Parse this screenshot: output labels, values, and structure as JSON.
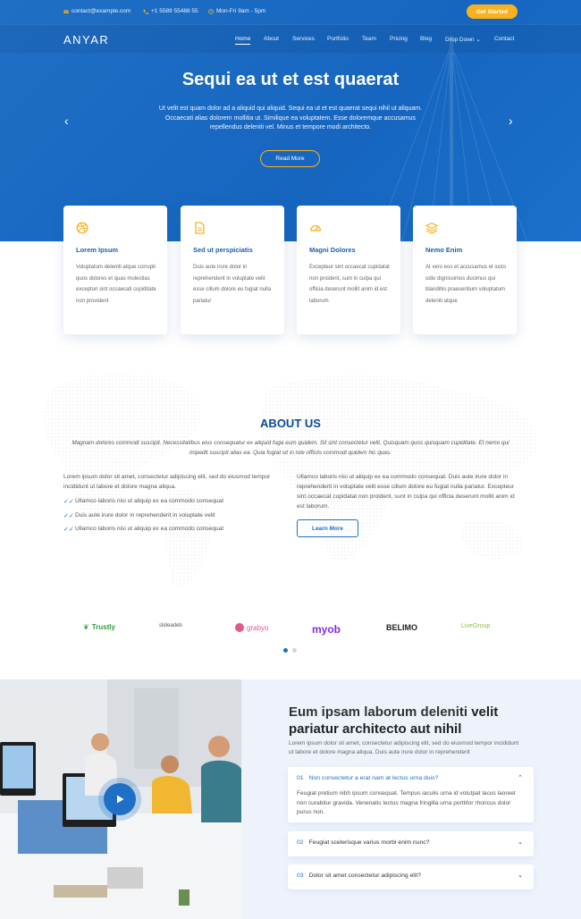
{
  "topbar": {
    "email": "contact@example.com",
    "phone": "+1 5589 55488 55",
    "hours": "Mon-Fri 9am - 5pm",
    "cta": "Get Started"
  },
  "brand": "ANYAR",
  "nav": [
    {
      "label": "Home",
      "active": true
    },
    {
      "label": "About"
    },
    {
      "label": "Services"
    },
    {
      "label": "Portfolio"
    },
    {
      "label": "Team"
    },
    {
      "label": "Pricing"
    },
    {
      "label": "Blog"
    },
    {
      "label": "Drop Down"
    },
    {
      "label": "Contact"
    }
  ],
  "hero": {
    "title": "Sequi ea ut et est quaerat",
    "text": "Ut velit est quam dolor ad a aliquid qui aliquid. Sequi ea ut et est quaerat sequi nihil ut aliquam. Occaecati alias dolorem mollitia ut. Similique ea voluptatem. Esse doloremque accusamus repellendus deleniti vel. Minus et tempore modi architecto.",
    "button": "Read More",
    "prev_icon": "chevron-left-icon",
    "next_icon": "chevron-right-icon"
  },
  "services": [
    {
      "icon": "dribbble-icon",
      "title": "Lorem Ipsum",
      "text": "Voluptatum deleniti atque corrupti quos dolores et quas molestias excepturi sint occaecati cupiditate non provident"
    },
    {
      "icon": "file-icon",
      "title": "Sed ut perspiciatis",
      "text": "Duis aute irure dolor in reprehenderit in voluptate velit esse cillum dolore eu fugiat nulla pariatur"
    },
    {
      "icon": "tachometer-icon",
      "title": "Magni Dolores",
      "text": "Excepteur sint occaecat cupidatat non proident, sunt in culpa qui officia deserunt mollit anim id est laborum"
    },
    {
      "icon": "layers-icon",
      "title": "Nemo Enim",
      "text": "At vero eos et accusamus et iusto odio dignissimos ducimus qui blanditiis praesentium voluptatum deleniti atque"
    }
  ],
  "about": {
    "title": "ABOUT US",
    "intro": "Magnam dolores commodi suscipit. Necessitatibus eius consequatur ex aliquid fuga eum quidem. Sit sint consectetur velit. Quisquam quos quisquam cupiditate. Et nemo qui impedit suscipit alias ea. Quia fugiat sit in iste officiis commodi quidem hic quas.",
    "col1": "Lorem ipsum dolor sit amet, consectetur adipiscing elit, sed do eiusmod tempor incididunt ut labore et dolore magna aliqua.",
    "list": [
      "Ullamco laboris nisi ut aliquip ex ea commodo consequat",
      "Duis aute irure dolor in reprehenderit in voluptate velit",
      "Ullamco laboris nisi ut aliquip ex ea commodo consequat"
    ],
    "col2": "Ullamco laboris nisi ut aliquip ex ea commodo consequat. Duis aute irure dolor in reprehenderit in voluptate velit esse cillum dolore eu fugiat nulla pariatur. Excepteur sint occaecat cupidatat non proident, sunt in culpa qui officia deserunt mollit anim id est laborum.",
    "button": "Learn More"
  },
  "clients": [
    {
      "name": "Trustly",
      "color": "#2f9e44"
    },
    {
      "name": "slideadeb",
      "color": "#555555"
    },
    {
      "name": "grabyo",
      "color": "#e05a8a"
    },
    {
      "name": "myob",
      "color": "#8a2be2"
    },
    {
      "name": "BELIMO",
      "color": "#222222"
    },
    {
      "name": "LiveGroup",
      "color": "#8fbf3f"
    }
  ],
  "faq": {
    "title_normal": "Eum ipsam laborum deleniti ",
    "title_bold": "velit pariatur architecto aut nihil",
    "subtitle": "Lorem ipsum dolor sit amet, consectetur adipiscing elit, sed do eiusmod tempor incididunt ut labore et dolore magna aliqua. Duis aute irure dolor in reprehenderit",
    "items": [
      {
        "num": "01",
        "question": "Non consectetur a erat nam at lectus urna duis?",
        "answer": "Feugiat pretium nibh ipsum consequat. Tempus iaculis urna id volutpat lacus laoreet non curabitur gravida. Venenatis lectus magna fringilla urna porttitor rhoncus dolor purus non.",
        "open": true
      },
      {
        "num": "02",
        "question": "Feugiat scelerisque varius morbi enim nunc?"
      },
      {
        "num": "03",
        "question": "Dolor sit amet consectetur adipiscing elit?"
      }
    ]
  },
  "colors": {
    "primary": "#1f6fc6",
    "accent": "#f9b21e",
    "heading": "#0b4a93"
  }
}
